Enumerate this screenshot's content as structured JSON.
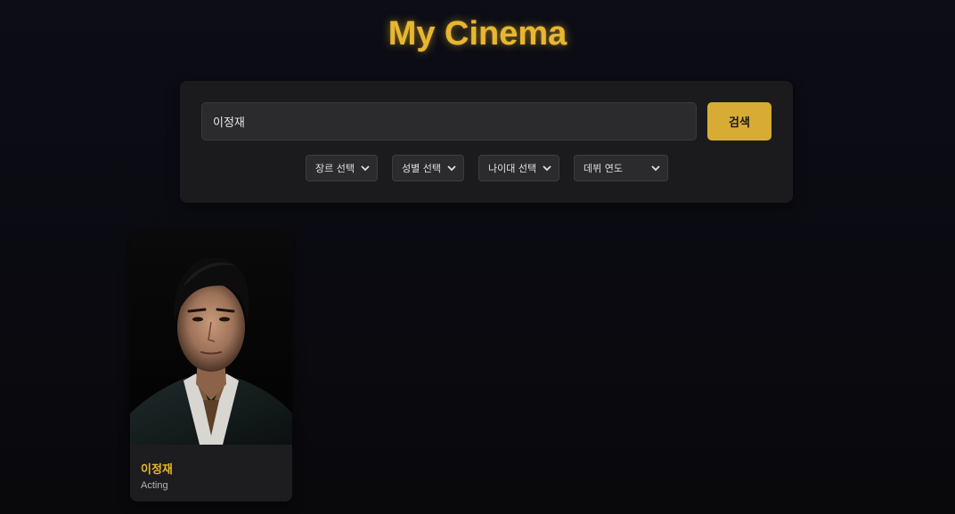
{
  "header": {
    "title": "My Cinema"
  },
  "search": {
    "query": "이정재",
    "button_label": "검색"
  },
  "filters": {
    "genre": "장르 선택",
    "gender": "성별 선택",
    "age": "나이대 선택",
    "debut_year": "데뷔 연도"
  },
  "results": [
    {
      "name": "이정재",
      "department": "Acting",
      "photo": "actor-portrait"
    }
  ],
  "colors": {
    "accent": "#e8b730",
    "button": "#d8ac34",
    "panel": "#1b1b1d",
    "background": "#0b0b12"
  }
}
